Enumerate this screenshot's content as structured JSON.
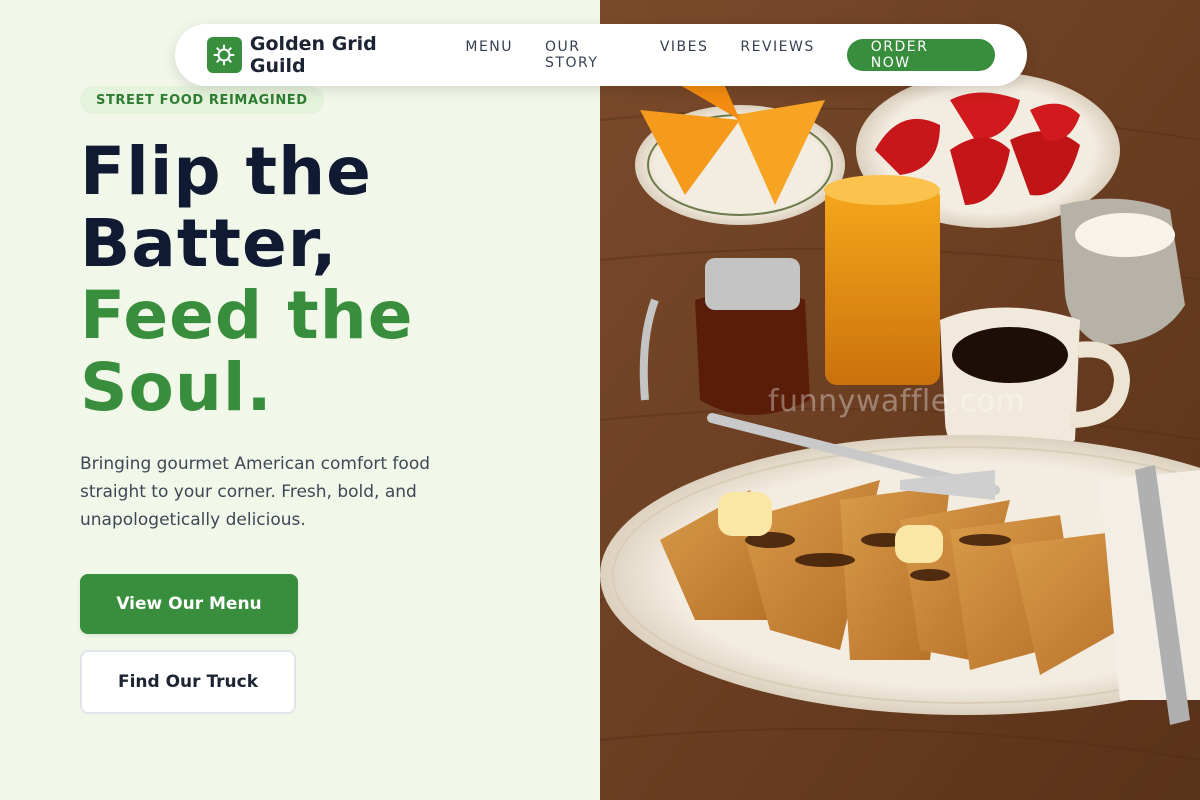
{
  "nav": {
    "brand": "Golden Grid Guild",
    "logo_icon": "sun-gear-icon",
    "links": [
      "MENU",
      "OUR STORY",
      "VIBES",
      "REVIEWS"
    ],
    "cta": "ORDER NOW"
  },
  "hero": {
    "badge": "STREET FOOD REIMAGINED",
    "headline_line1": "Flip the",
    "headline_line2": "Batter,",
    "headline_line3": "Feed the",
    "headline_line4": "Soul.",
    "description": "Bringing gourmet American comfort food straight to your corner. Fresh, bold, and unapologetically delicious.",
    "primary_button": "View Our Menu",
    "secondary_button": "Find Our Truck"
  },
  "image": {
    "watermark": "funnywaffle.com"
  },
  "colors": {
    "accent": "#388e3c",
    "background": "#f1f8e9",
    "headline_dark": "#111a33"
  }
}
